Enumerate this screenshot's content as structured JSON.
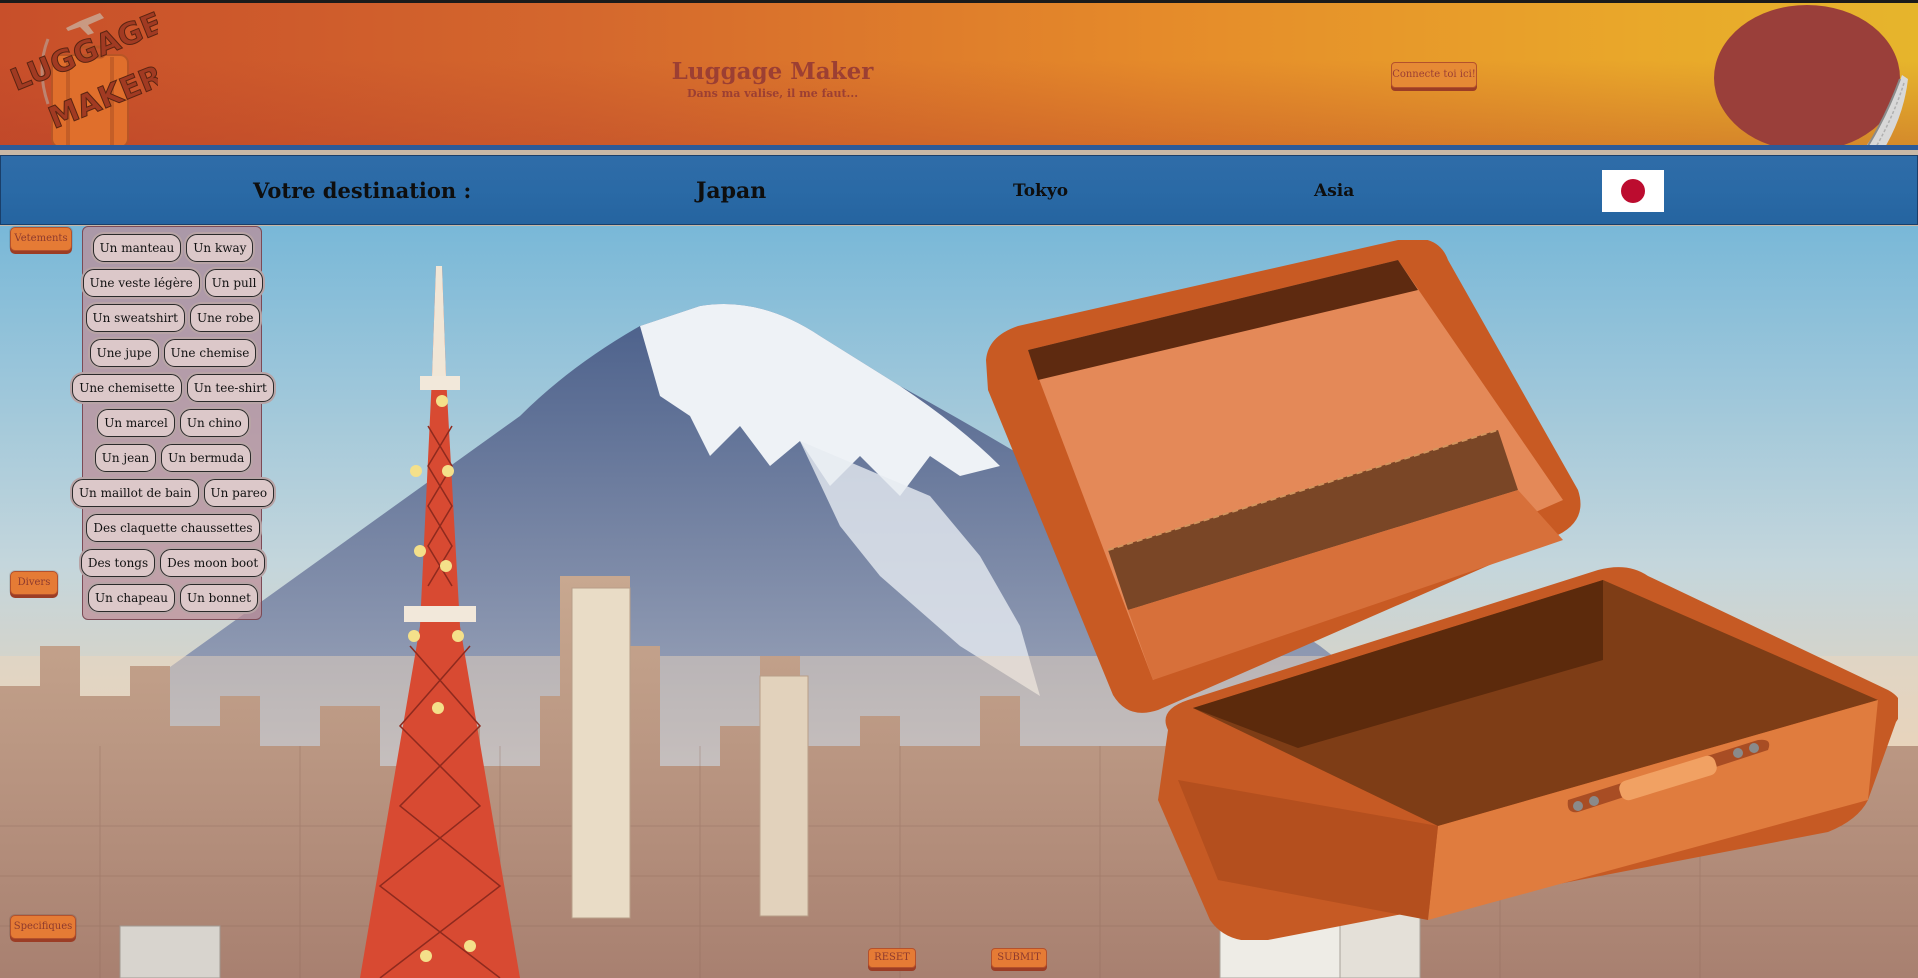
{
  "header": {
    "logo_line1": "LUGGAGE",
    "logo_line2": "MAKER",
    "title": "Luggage Maker",
    "subtitle": "Dans ma valise, il me faut...",
    "login_label": "Connecte toi ici!"
  },
  "destination": {
    "label": "Votre destination :",
    "country": "Japan",
    "city": "Tokyo",
    "continent": "Asia",
    "flag_icon": "japan-flag-icon"
  },
  "categories": {
    "vetements": "Vetements",
    "divers": "Divers",
    "specifiques": "Specifiques"
  },
  "clothing_rows": [
    [
      "Un manteau",
      "Un kway"
    ],
    [
      "Une veste légère",
      "Un pull"
    ],
    [
      "Un sweatshirt",
      "Une robe"
    ],
    [
      "Une jupe",
      "Une chemise"
    ],
    [
      "Une chemisette",
      "Un tee-shirt"
    ],
    [
      "Un marcel",
      "Un chino"
    ],
    [
      "Un jean",
      "Un bermuda"
    ],
    [
      "Un maillot de bain",
      "Un pareo"
    ],
    [
      "Des claquette chaussettes"
    ],
    [
      "Des tongs",
      "Des moon boot"
    ],
    [
      "Un chapeau",
      "Un bonnet"
    ]
  ],
  "actions": {
    "reset": "RESET",
    "submit": "SUBMIT"
  },
  "colors": {
    "header_orange": "#e58a2a",
    "nav_blue": "#2a6aa6",
    "button_orange": "#e57b35",
    "brand_text": "#9c3f33",
    "flag_red": "#bc0c2f"
  }
}
